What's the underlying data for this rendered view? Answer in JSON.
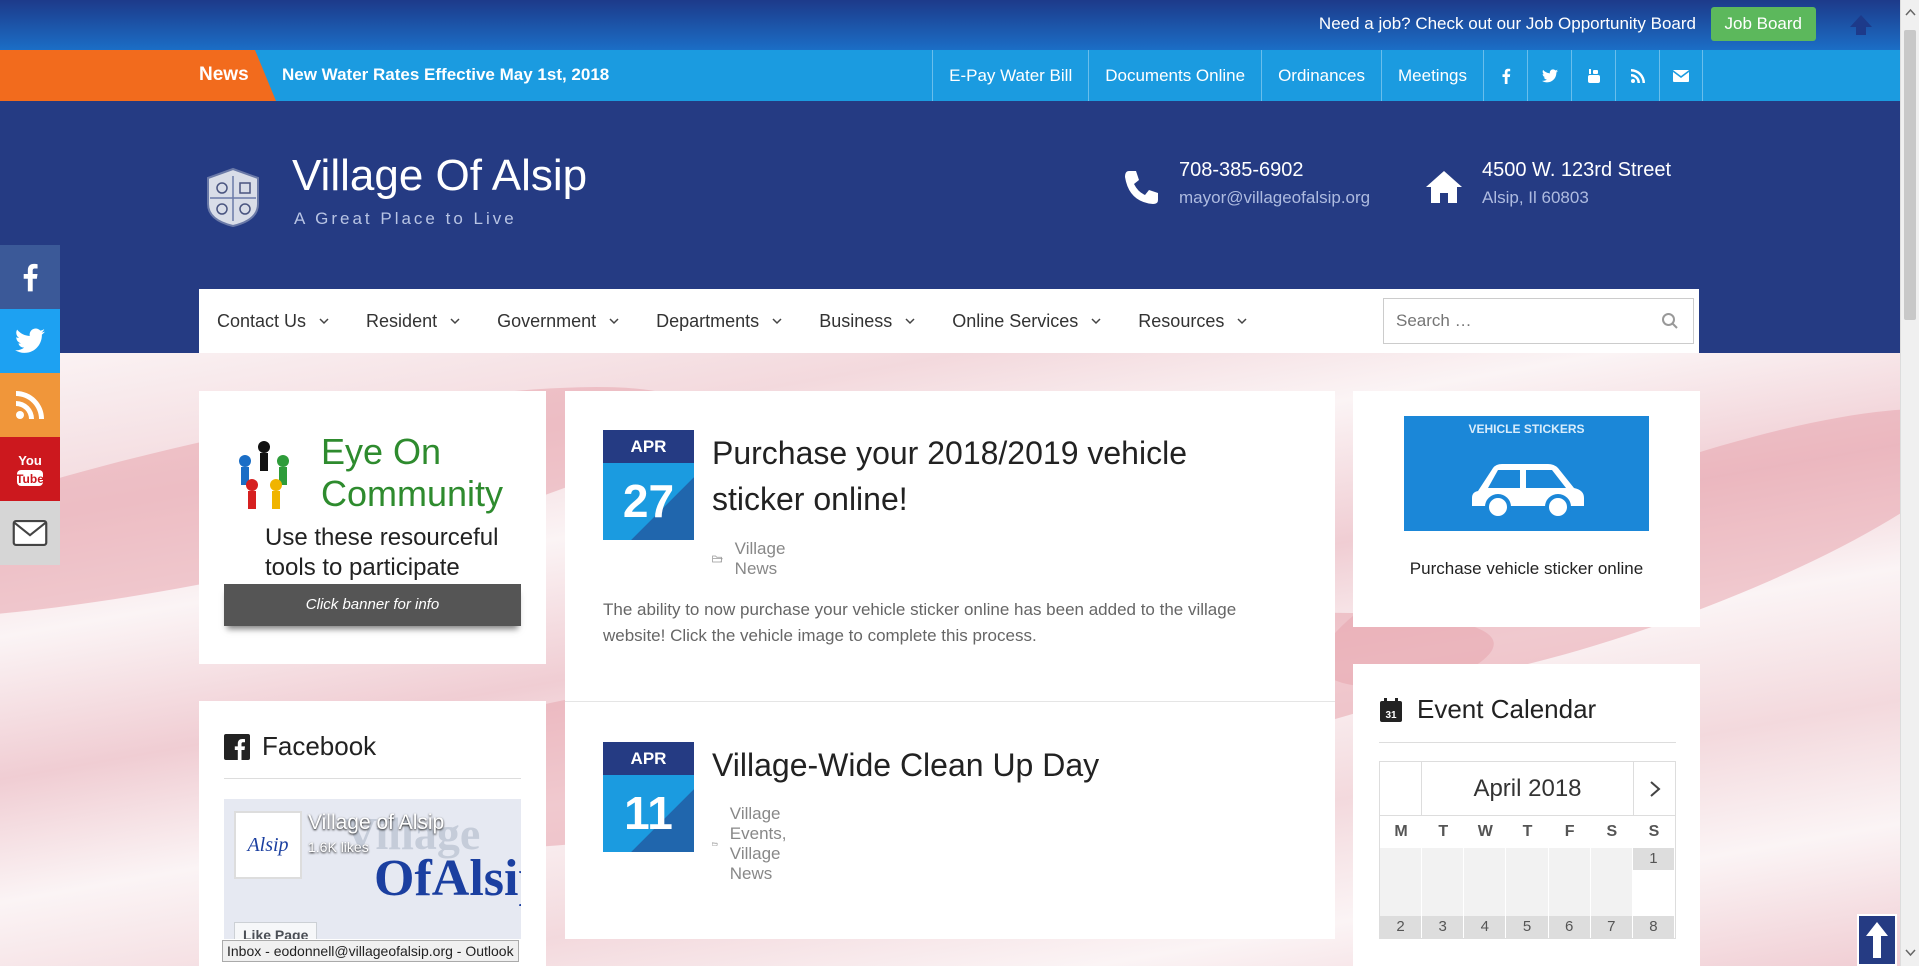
{
  "topbar": {
    "job_text": "Need a job? Check out our Job Opportunity Board",
    "job_button": "Job Board"
  },
  "newsbar": {
    "label": "News",
    "headline": "New Water Rates Effective May 1st, 2018",
    "links": [
      "E-Pay Water Bill",
      "Documents Online",
      "Ordinances",
      "Meetings"
    ],
    "social_icons": [
      "facebook-icon",
      "twitter-icon",
      "youtube-icon",
      "rss-icon",
      "envelope-icon"
    ]
  },
  "header": {
    "title": "Village Of Alsip",
    "tagline": "A Great Place to Live",
    "phone": "708-385-6902",
    "email": "mayor@villageofalsip.org",
    "address1": "4500 W. 123rd Street",
    "address2": "Alsip, Il 60803"
  },
  "nav": {
    "items": [
      "Contact Us",
      "Resident",
      "Government",
      "Departments",
      "Business",
      "Online Services",
      "Resources"
    ],
    "search_placeholder": "Search …"
  },
  "side_social": [
    "facebook-icon",
    "twitter-icon",
    "rss-icon",
    "youtube-icon",
    "envelope-icon"
  ],
  "eye_card": {
    "title": "Eye On Community",
    "subtitle": "Use these resourceful tools to participate",
    "banner": "Click banner for info"
  },
  "facebook": {
    "heading": "Facebook",
    "page_name": "Village of Alsip",
    "likes": "1.6K likes",
    "like_button": "Like Page",
    "cover_text": "Village",
    "cover_text2": "OfAlsip",
    "profile_text": "Alsip"
  },
  "posts": [
    {
      "month": "APR",
      "day": "27",
      "title": "Purchase your 2018/2019 vehicle sticker online!",
      "categories": "Village News",
      "excerpt": "The ability to now purchase your vehicle sticker online has been added to the village website!  Click the vehicle image to complete this process."
    },
    {
      "month": "APR",
      "day": "11",
      "title": "Village-Wide Clean Up Day",
      "categories": "Village Events,  Village News"
    }
  ],
  "vehicle": {
    "image_label": "VEHICLE STICKERS",
    "caption": "Purchase vehicle sticker online"
  },
  "calendar": {
    "heading": "Event Calendar",
    "icon_day": "31",
    "month": "April 2018",
    "weekdays": [
      "M",
      "T",
      "W",
      "T",
      "F",
      "S",
      "S"
    ],
    "week1_last": "1",
    "week2": [
      "2",
      "3",
      "4",
      "5",
      "6",
      "7",
      "8"
    ]
  },
  "statusbar": "Inbox - eodonnell@villageofalsip.org - Outlook",
  "colors": {
    "navy": "#253b83",
    "blue": "#1b9be0",
    "orange": "#f26b1d",
    "green": "#5cb85c"
  }
}
